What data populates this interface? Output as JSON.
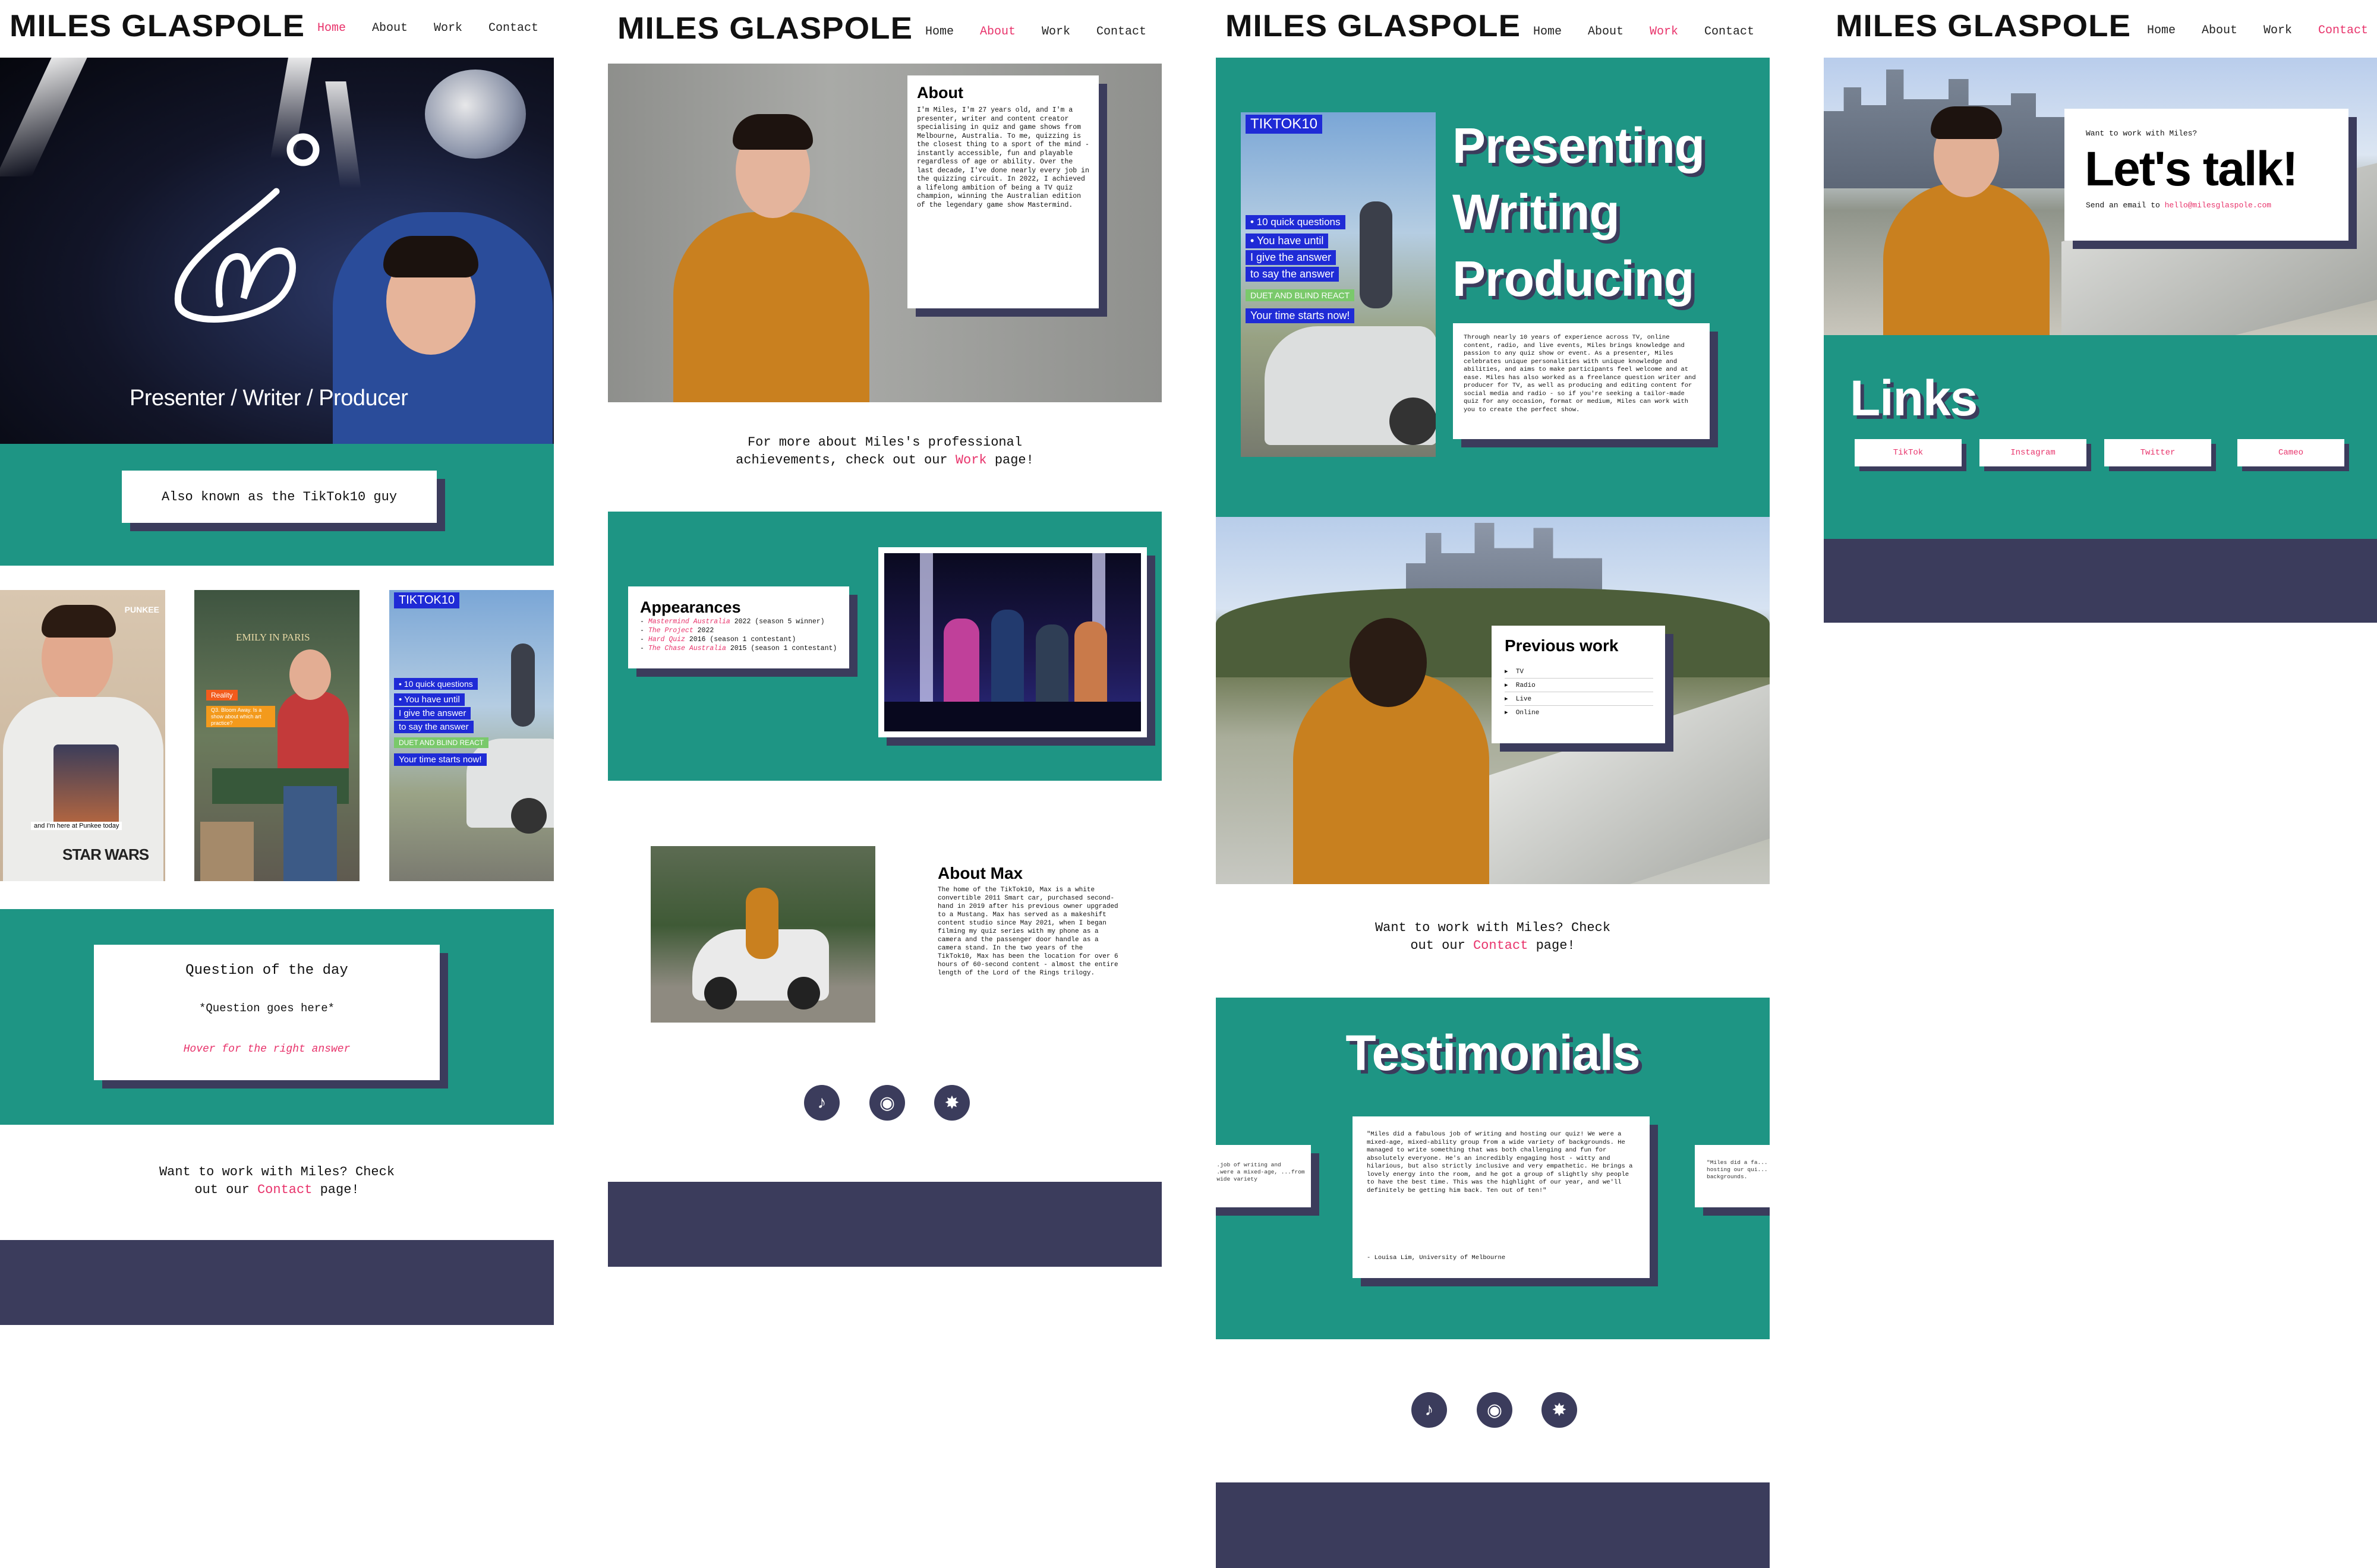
{
  "site": {
    "logo": "MILES GLASPOLE"
  },
  "nav": {
    "home": "Home",
    "about": "About",
    "work": "Work",
    "contact": "Contact"
  },
  "colors": {
    "teal": "#1e9584",
    "navy": "#3b3c5c",
    "pink": "#e8336b",
    "blue_chip": "#1f2bd6",
    "green_chip": "#7ac96b"
  },
  "home": {
    "hero_tagline": "Presenter / Writer / Producer",
    "aka": "Also known as the TikTok10 guy",
    "punkee": {
      "brand": "PUNKEE",
      "caption": "and I'm here at Punkee today",
      "shirt": "STAR WARS"
    },
    "reality": {
      "sign": "EMILY IN PARIS",
      "chip1": "Reality",
      "chip2": "Q3. Bloom Away. Is a show about which art practice?"
    },
    "tiktok": {
      "title": "TIKTOK10",
      "chips": [
        "• 10 quick questions",
        "• You have until",
        "I give the answer",
        "to say the answer",
        "DUET AND BLIND REACT",
        "Your time starts now!"
      ]
    },
    "qotd": {
      "title": "Question of the day",
      "question": "*Question goes here*",
      "hint": "Hover for the right answer"
    },
    "cta_line1": "Want to work with Miles? Check",
    "cta_pre": "out our ",
    "cta_link": "Contact",
    "cta_post": " page!"
  },
  "about": {
    "card_title": "About",
    "card_body": "I'm Miles, I'm 27 years old, and I'm a presenter, writer and content creator specialising in quiz and game shows from Melbourne, Australia. To me, quizzing is the closest thing to a sport of the mind - instantly accessible, fun and playable regardless of age or ability. Over the last decade, I've done nearly every job in the quizzing circuit. In 2022, I achieved a lifelong ambition of being a TV quiz champion, winning the Australian edition of the legendary game show Mastermind.",
    "more_line1": "For more about Miles's professional",
    "more_pre": "achievements, check out our ",
    "more_link": "Work",
    "more_post": " page!",
    "appearances_title": "Appearances",
    "appearances": [
      {
        "show": "Mastermind Australia",
        "detail": " 2022 (season 5 winner)"
      },
      {
        "show": "The Project",
        "detail": " 2022"
      },
      {
        "show": "Hard Quiz",
        "detail": " 2016 (season 1 contestant)"
      },
      {
        "show": "The Chase Australia",
        "detail": " 2015 (season 1 contestant)"
      }
    ],
    "max_title": "About Max",
    "max_body": "The home of the TikTok10, Max is a white convertible 2011 Smart car, purchased second-hand in 2019 after his previous owner upgraded to a Mustang. Max has served as a makeshift content studio since May 2021, when I began filming my quiz series with my phone as a camera and the passenger door handle as a camera stand. In the two years of the TikTok10, Max has been the location for over 6 hours of 60-second content - almost the entire length of the Lord of the Rings trilogy."
  },
  "work": {
    "roles": [
      "Presenting",
      "Writing",
      "Producing"
    ],
    "tiktok": {
      "title": "TIKTOK10",
      "chips": [
        "• 10 quick questions",
        "• You have until",
        "I give the answer",
        "to say the answer",
        "DUET AND BLIND REACT",
        "Your time starts now!"
      ]
    },
    "body": "Through nearly 10 years of experience across TV, online content, radio, and live events, Miles brings knowledge and passion to any quiz show or event. As a presenter, Miles celebrates unique personalities with unique knowledge and abilities, and aims to make participants feel welcome and at ease. Miles has also worked as a freelance question writer and producer for TV, as well as producing and editing content for social media and radio - so if you're seeking a tailor-made quiz for any occasion, format or medium, Miles can work with you to create the perfect show.",
    "previous_title": "Previous work",
    "previous_items": [
      "TV",
      "Radio",
      "Live",
      "Online"
    ],
    "cta_line1": "Want to work with Miles? Check",
    "cta_pre": "out our ",
    "cta_link": "Contact",
    "cta_post": " page!",
    "testimonials_title": "Testimonials",
    "testimonial_quote": "\"Miles did a fabulous job of writing and hosting our quiz! We were a mixed-age, mixed-ability group from a wide variety of backgrounds. He managed to write something that was both challenging and fun for absolutely everyone. He's an incredibly engaging host - witty and hilarious, but also strictly inclusive and very empathetic. He brings a lovely energy into the room, and he got a group of slightly shy people to have the best time. This was the highlight of our year, and we'll definitely be getting him back. Ten out of ten!\"",
    "testimonial_author": "- Louisa Lim, University of Melbourne",
    "side_left": "...job of writing and ...were a mixed-age, ...from a wide variety",
    "side_right": "\"Miles did a fa... hosting our qui... of backgrounds."
  },
  "contact": {
    "small": "Want to work with Miles?",
    "title": "Let's talk!",
    "email_pre": "Send an email to ",
    "email": "hello@milesglaspole.com",
    "links_title": "Links",
    "links": [
      "TikTok",
      "Instagram",
      "Twitter",
      "Cameo"
    ]
  }
}
